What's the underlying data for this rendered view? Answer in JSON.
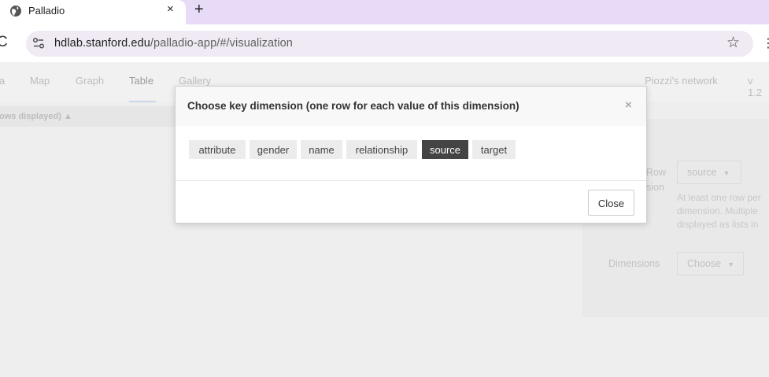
{
  "browser": {
    "tab_title": "Palladio",
    "tab_close": "×",
    "new_tab": "+",
    "url_host": "hdlab.stanford.edu",
    "url_path": "/palladio-app/#/visualization",
    "reload_glyph": "C",
    "star_glyph": "☆",
    "menu_glyph": "⋮"
  },
  "nav": {
    "items": [
      "a",
      "Map",
      "Graph",
      "Table",
      "Gallery"
    ],
    "active": "Table",
    "project_title": "Piozzi's network",
    "version": "v 1.2"
  },
  "subbar": {
    "text": "ows displayed)  ▲"
  },
  "side_panel": {
    "row_label_1": "Row",
    "row_label_2": "sion",
    "row_value": "source",
    "help_lines": [
      "At least one row per",
      "dimension. Multiple",
      "displayed as lists in"
    ],
    "dimensions_label": "Dimensions",
    "dimensions_value": "Choose",
    "caret": "▼"
  },
  "modal": {
    "title": "Choose key dimension (one row for each value of this dimension)",
    "close_x": "×",
    "options": [
      "attribute",
      "gender",
      "name",
      "relationship",
      "source",
      "target"
    ],
    "selected": "source",
    "close_button": "Close"
  },
  "colors": {
    "tabbar": "#e7dbf7",
    "selected_chip": "#444444",
    "chip": "#ececec"
  }
}
